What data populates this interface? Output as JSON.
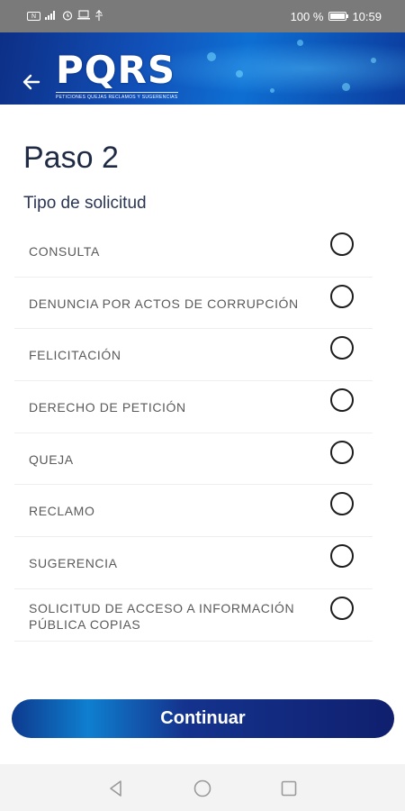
{
  "status_bar": {
    "battery_text": "100 %",
    "time": "10:59",
    "left_icons": [
      "nfc-icon",
      "signal-icon",
      "alarm-icon",
      "laptop-icon",
      "usb-icon"
    ]
  },
  "header": {
    "logo_text": "PQRS",
    "logo_subtitle": "PETICIONES QUEJAS RECLAMOS Y SUGERENCIAS",
    "colors": {
      "banner": "#1150b8",
      "accent": "#5fc8ff"
    }
  },
  "main": {
    "title": "Paso 2",
    "section_label": "Tipo de solicitud",
    "options": [
      {
        "label": "CONSULTA",
        "selected": false
      },
      {
        "label": "DENUNCIA POR ACTOS DE CORRUPCIÓN",
        "selected": false
      },
      {
        "label": "FELICITACIÓN",
        "selected": false
      },
      {
        "label": "DERECHO DE PETICIÓN",
        "selected": false
      },
      {
        "label": "QUEJA",
        "selected": false
      },
      {
        "label": "RECLAMO",
        "selected": false
      },
      {
        "label": "SUGERENCIA",
        "selected": false
      },
      {
        "label": "SOLICITUD DE ACCESO A INFORMACIÓN PÚBLICA COPIAS",
        "selected": false
      }
    ]
  },
  "footer": {
    "continue_label": "Continuar"
  }
}
